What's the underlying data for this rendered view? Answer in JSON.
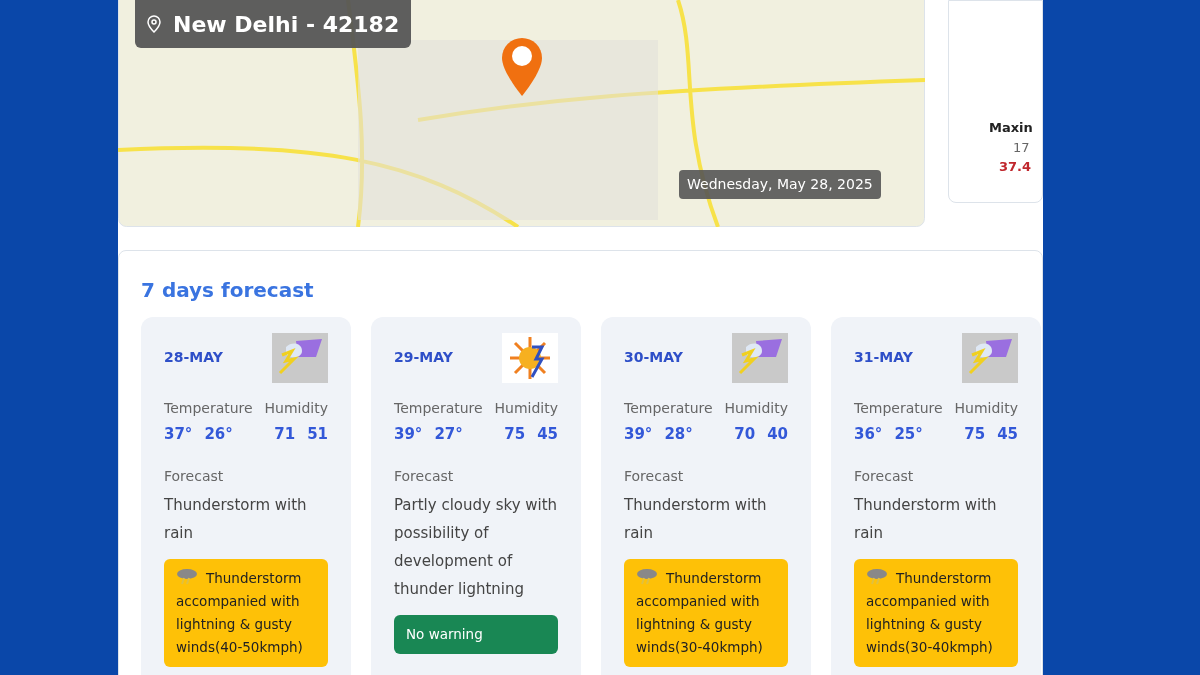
{
  "map": {
    "location": "New Delhi - 42182",
    "date": "Wednesday, May 28, 2025"
  },
  "side_panel": {
    "label": "Maxin",
    "value_1": "17",
    "value_2": "37.4"
  },
  "forecast": {
    "title": "7 days forecast",
    "days": [
      {
        "date": "28-MAY",
        "kind": "storm",
        "temperature_label": "Temperature",
        "humidity_label": "Humidity",
        "temp_max": "37°",
        "temp_min": "26°",
        "humidity_max": "71",
        "humidity_min": "51",
        "forecast_label": "Forecast",
        "forecast": "Thunderstorm with rain",
        "warning": {
          "kind": "thunderstorm",
          "text": "Thunderstorm accompanied with lightning & gusty winds(40-50kmph)"
        }
      },
      {
        "date": "29-MAY",
        "kind": "sunny",
        "temperature_label": "Temperature",
        "humidity_label": "Humidity",
        "temp_max": "39°",
        "temp_min": "27°",
        "humidity_max": "75",
        "humidity_min": "45",
        "forecast_label": "Forecast",
        "forecast": "Partly cloudy sky with possibility of development of thunder lightning",
        "warning": {
          "kind": "none",
          "text": "No warning"
        }
      },
      {
        "date": "30-MAY",
        "kind": "storm",
        "temperature_label": "Temperature",
        "humidity_label": "Humidity",
        "temp_max": "39°",
        "temp_min": "28°",
        "humidity_max": "70",
        "humidity_min": "40",
        "forecast_label": "Forecast",
        "forecast": "Thunderstorm with rain",
        "warning": {
          "kind": "thunderstorm",
          "text": "Thunderstorm accompanied with lightning & gusty winds(30-40kmph)"
        }
      },
      {
        "date": "31-MAY",
        "kind": "storm",
        "temperature_label": "Temperature",
        "humidity_label": "Humidity",
        "temp_max": "36°",
        "temp_min": "25°",
        "humidity_max": "75",
        "humidity_min": "45",
        "forecast_label": "Forecast",
        "forecast": "Thunderstorm with rain",
        "warning": {
          "kind": "thunderstorm",
          "text": "Thunderstorm accompanied with lightning & gusty winds(30-40kmph)"
        }
      }
    ]
  }
}
